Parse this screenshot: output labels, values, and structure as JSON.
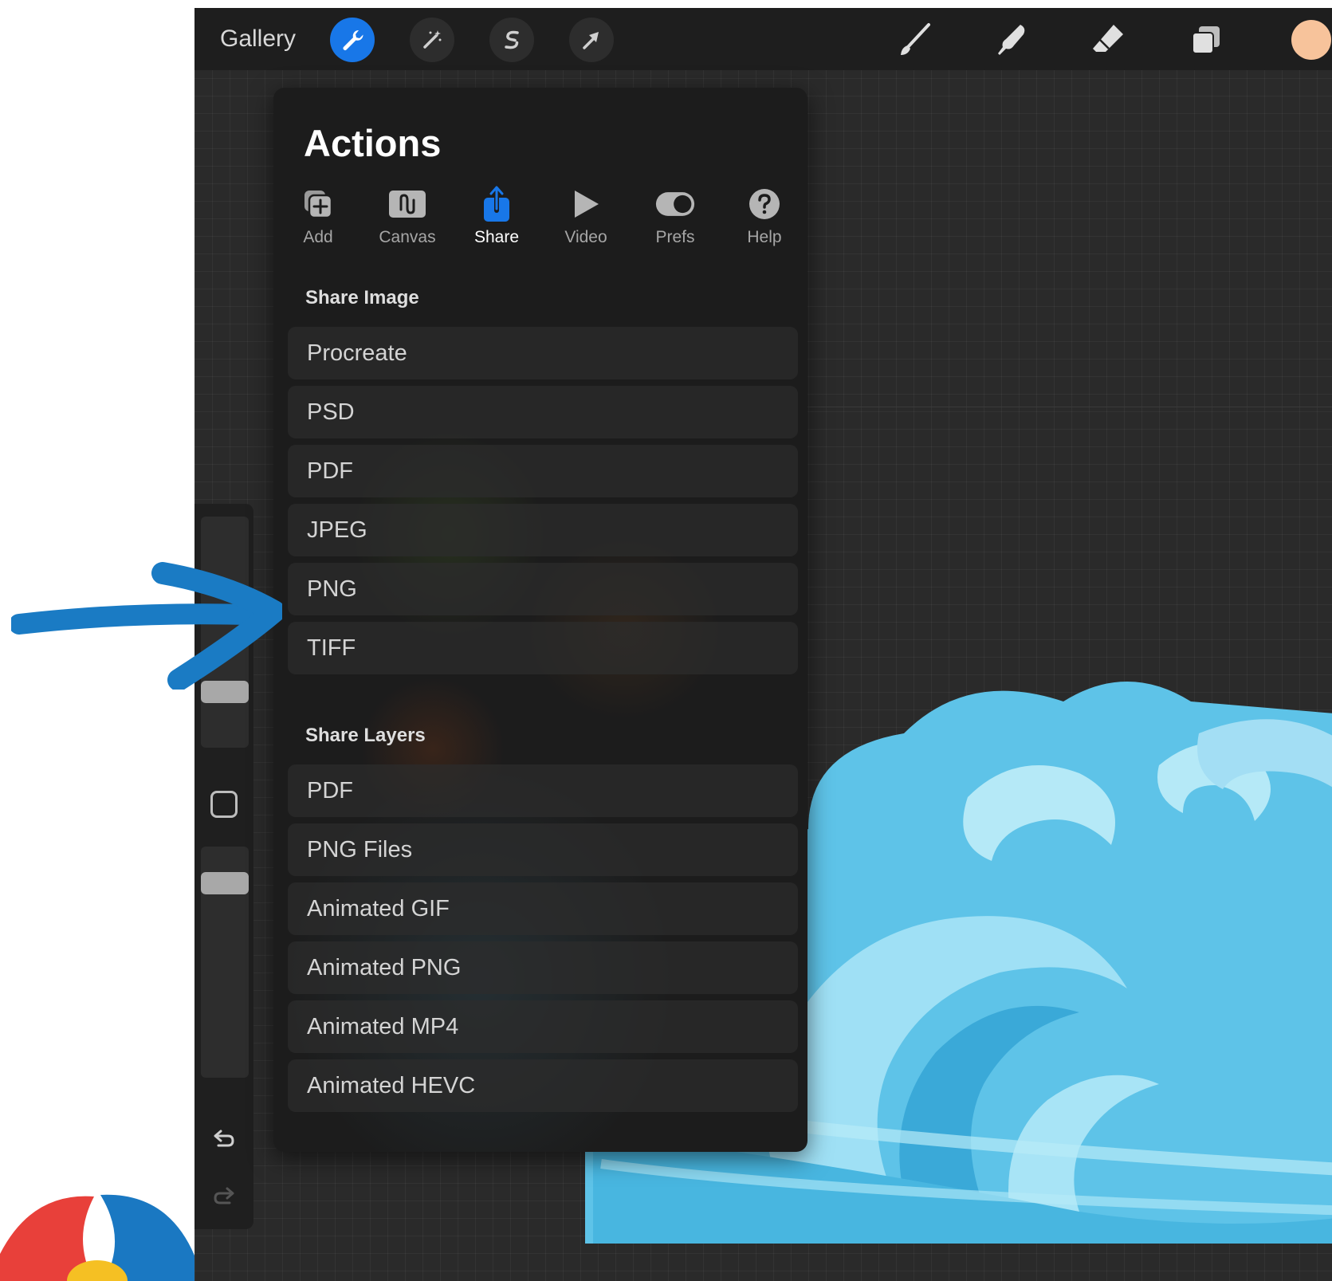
{
  "toolbar": {
    "gallery_label": "Gallery",
    "left_tools": [
      {
        "name": "actions",
        "icon": "wrench-icon",
        "active": true
      },
      {
        "name": "adjustments",
        "icon": "magic-wand-icon",
        "active": false
      },
      {
        "name": "selection",
        "icon": "selection-s-icon",
        "active": false
      },
      {
        "name": "transform",
        "icon": "arrow-cursor-icon",
        "active": false
      }
    ],
    "right_tools": [
      {
        "name": "brush",
        "icon": "brush-icon"
      },
      {
        "name": "smudge",
        "icon": "smudge-icon"
      },
      {
        "name": "eraser",
        "icon": "eraser-icon"
      },
      {
        "name": "layers",
        "icon": "layers-icon"
      }
    ],
    "current_color": "#f7c39b",
    "accent_color": "#1877e8"
  },
  "actions_panel": {
    "title": "Actions",
    "tabs": [
      {
        "label": "Add",
        "icon": "add-icon",
        "active": false
      },
      {
        "label": "Canvas",
        "icon": "canvas-icon",
        "active": false
      },
      {
        "label": "Share",
        "icon": "share-icon",
        "active": true
      },
      {
        "label": "Video",
        "icon": "play-icon",
        "active": false
      },
      {
        "label": "Prefs",
        "icon": "toggle-icon",
        "active": false
      },
      {
        "label": "Help",
        "icon": "help-icon",
        "active": false
      }
    ],
    "share_image": {
      "header": "Share Image",
      "items": [
        "Procreate",
        "PSD",
        "PDF",
        "JPEG",
        "PNG",
        "TIFF"
      ]
    },
    "share_layers": {
      "header": "Share Layers",
      "items": [
        "PDF",
        "PNG Files",
        "Animated GIF",
        "Animated PNG",
        "Animated MP4",
        "Animated HEVC"
      ]
    }
  },
  "sidebar": {
    "icons": [
      "modify-icon",
      "undo-icon",
      "redo-icon"
    ]
  },
  "annotation": {
    "arrow_color": "#1a7bc4",
    "points_to": "PNG"
  }
}
